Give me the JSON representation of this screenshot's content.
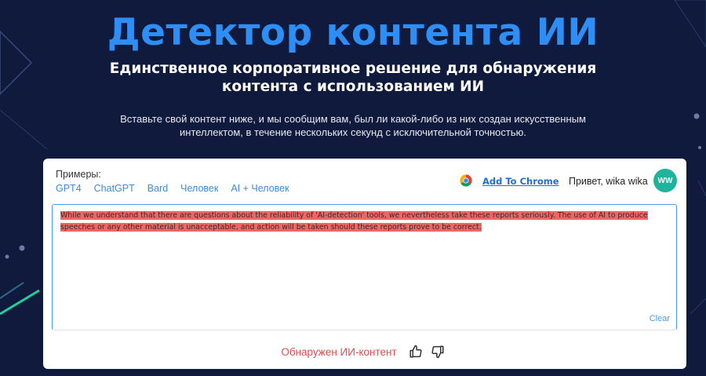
{
  "hero": {
    "title": "Детектор контента ИИ",
    "subtitle": "Единственное корпоративное решение для обнаружения контента с использованием ИИ",
    "description": "Вставьте свой контент ниже, и мы сообщим вам, был ли какой-либо из них создан искусственным интеллектом, в течение нескольких секунд с исключительной точностью."
  },
  "card": {
    "examples_label": "Примеры:",
    "examples": [
      "GPT4",
      "ChatGPT",
      "Bard",
      "Человек",
      "AI + Человек"
    ],
    "add_chrome_label": "Add To Chrome",
    "greeting": "Привет, wika wika",
    "avatar_initials": "WW",
    "input_text": "While we understand that there are questions about the reliability of 'AI-detection' tools, we nevertheless take these reports seriously. The use of AI to produce speeches or any other material is unacceptable, and action will be taken should these reports prove to be correct.",
    "clear_label": "Clear",
    "result_label": "Обнаружен ИИ-контент"
  },
  "colors": {
    "background": "#0f1a3d",
    "title_blue": "#2d8ff5",
    "highlight_red": "#ef6666",
    "result_red": "#e34b4b",
    "avatar_teal": "#1fb39b"
  },
  "icons": [
    "chrome-icon",
    "thumbs-up-icon",
    "thumbs-down-icon"
  ]
}
